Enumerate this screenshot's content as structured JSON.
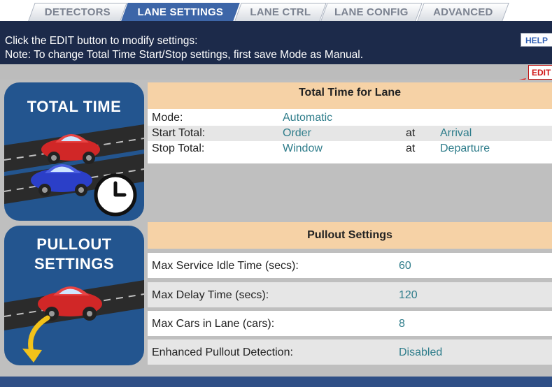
{
  "tabs": [
    {
      "label": "DETECTORS",
      "active": false
    },
    {
      "label": "LANE SETTINGS",
      "active": true
    },
    {
      "label": "LANE CTRL",
      "active": false
    },
    {
      "label": "LANE CONFIG",
      "active": false
    },
    {
      "label": "ADVANCED",
      "active": false
    }
  ],
  "header": {
    "line1": "Click the EDIT button to modify settings:",
    "line2": "Note: To change Total Time Start/Stop settings, first save Mode as Manual.",
    "help_label": "HELP"
  },
  "edit_label": "EDIT",
  "total_time": {
    "icon_title": "TOTAL TIME",
    "heading": "Total Time for Lane",
    "rows": [
      {
        "label": "Mode:",
        "value": "Automatic",
        "at": "",
        "value2": ""
      },
      {
        "label": "Start Total:",
        "value": "Order",
        "at": "at",
        "value2": "Arrival"
      },
      {
        "label": "Stop Total:",
        "value": "Window",
        "at": "at",
        "value2": "Departure"
      }
    ]
  },
  "pullout": {
    "icon_title_line1": "PULLOUT",
    "icon_title_line2": "SETTINGS",
    "heading": "Pullout Settings",
    "rows": [
      {
        "label": "Max Service Idle Time (secs):",
        "value": "60"
      },
      {
        "label": "Max Delay Time (secs):",
        "value": "120"
      },
      {
        "label": "Max Cars in Lane (cars):",
        "value": "8"
      },
      {
        "label": "Enhanced Pullout Detection:",
        "value": "Disabled"
      }
    ]
  },
  "colors": {
    "accent_blue": "#3d66a8",
    "header_navy": "#1c2a4a",
    "section_head": "#f6d2a6",
    "value_teal": "#2f7d8b",
    "edit_red": "#d01818"
  }
}
